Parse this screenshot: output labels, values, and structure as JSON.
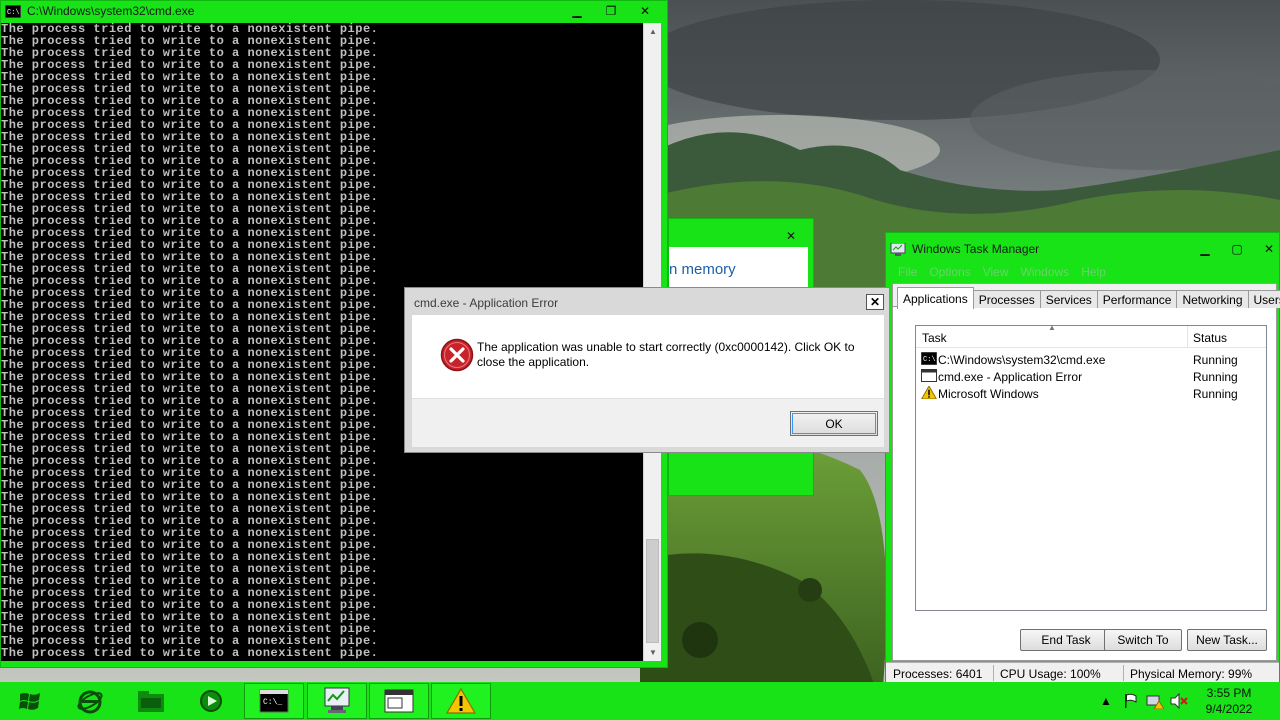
{
  "cmd_window": {
    "title": "C:\\Windows\\system32\\cmd.exe",
    "line_text": "The process tried to write to a nonexistent pipe.",
    "line_count": 53
  },
  "background_window": {
    "text": "n memory"
  },
  "error_dialog": {
    "title": "cmd.exe - Application Error",
    "message": "The application was unable to start correctly (0xc0000142). Click OK to close the application.",
    "ok_label": "OK",
    "close_label": "✕"
  },
  "task_manager": {
    "title": "Windows Task Manager",
    "menu": [
      "File",
      "Options",
      "View",
      "Windows",
      "Help"
    ],
    "tabs": [
      "Applications",
      "Processes",
      "Services",
      "Performance",
      "Networking",
      "Users"
    ],
    "active_tab": "Applications",
    "columns": {
      "task": "Task",
      "status": "Status"
    },
    "rows": [
      {
        "task": "C:\\Windows\\system32\\cmd.exe",
        "status": "Running",
        "icon": "console-icon"
      },
      {
        "task": "cmd.exe - Application Error",
        "status": "Running",
        "icon": "window-icon"
      },
      {
        "task": "Microsoft Windows",
        "status": "Running",
        "icon": "warning-icon"
      }
    ],
    "buttons": {
      "end_task": "End Task",
      "switch_to": "Switch To",
      "new_task": "New Task..."
    },
    "status_bar": {
      "processes": "Processes: 6401",
      "cpu": "CPU Usage: 100%",
      "memory": "Physical Memory: 99%"
    }
  },
  "taskbar": {
    "time": "3:55 PM",
    "date": "9/4/2022",
    "items": [
      "start-orb-icon",
      "internet-explorer-icon",
      "file-explorer-icon",
      "media-player-icon",
      "cmd-taskbar-icon",
      "task-manager-taskbar-icon",
      "error-window-taskbar-icon",
      "warning-taskbar-icon"
    ]
  },
  "colors": {
    "window_frame": "#17e317",
    "console_bg": "#000000",
    "console_text": "#c0c0c0",
    "error_red": "#c8232b"
  }
}
